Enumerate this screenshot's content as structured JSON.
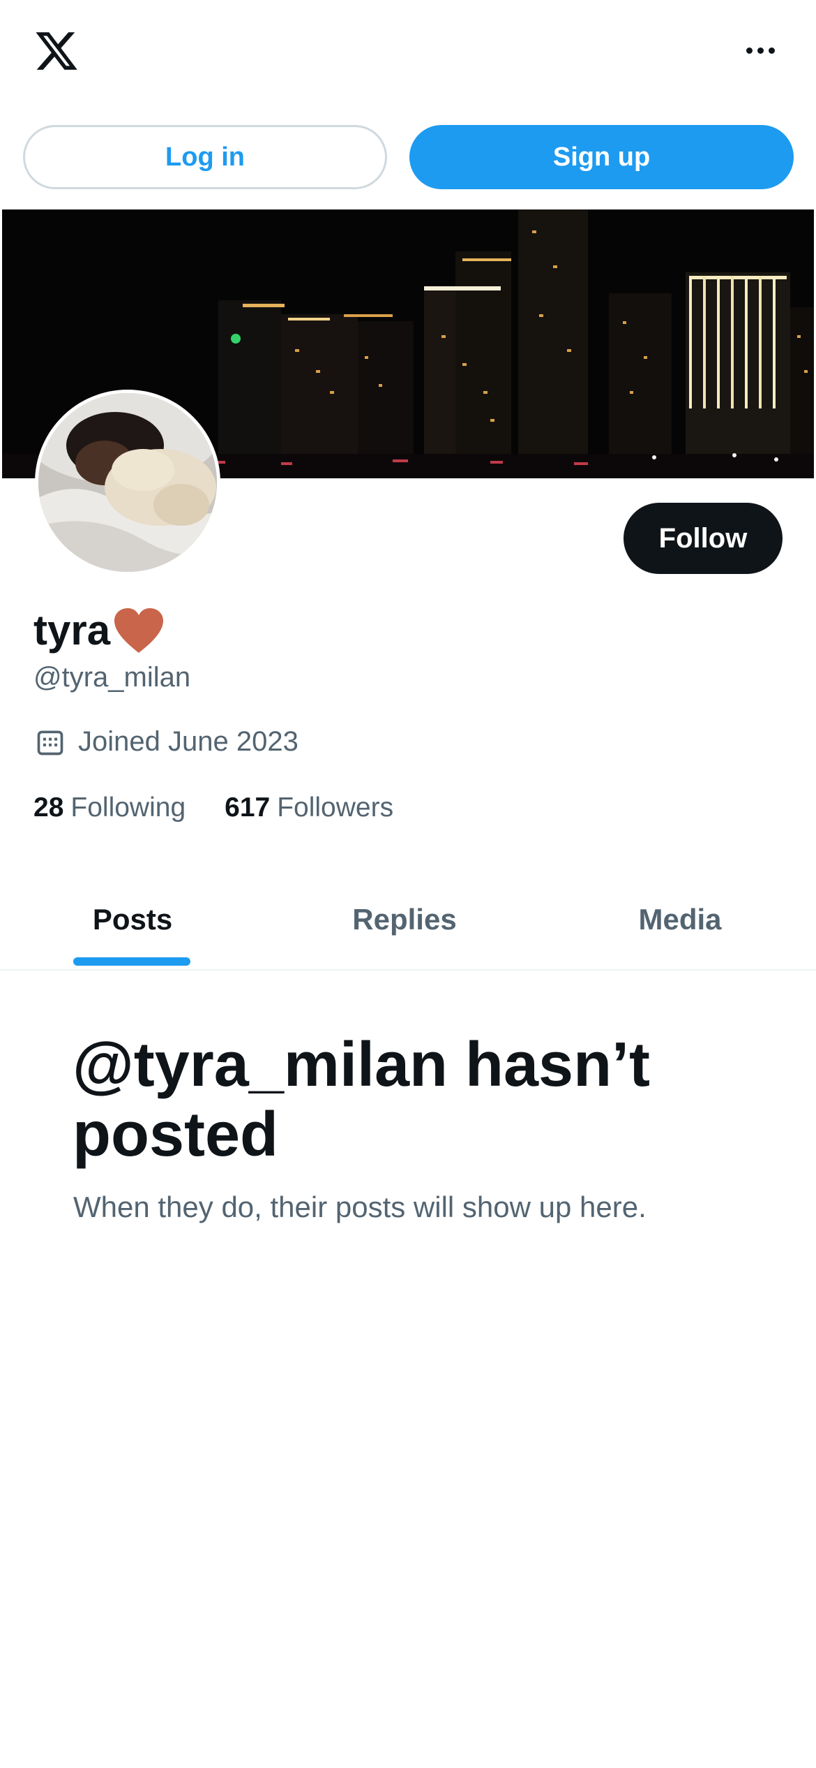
{
  "header": {
    "logo": "x-logo-icon",
    "more": "more-options-icon"
  },
  "auth": {
    "login_label": "Log in",
    "signup_label": "Sign up"
  },
  "profile": {
    "display_name": "tyra",
    "name_emoji": "heart",
    "handle": "@tyra_milan",
    "joined": "Joined June 2023",
    "following_count": "28",
    "following_label": "Following",
    "followers_count": "617",
    "followers_label": "Followers",
    "follow_label": "Follow"
  },
  "tabs": [
    {
      "label": "Posts",
      "active": true
    },
    {
      "label": "Replies",
      "active": false
    },
    {
      "label": "Media",
      "active": false
    }
  ],
  "empty_state": {
    "title": "@tyra_milan hasn’t posted",
    "subtitle": "When they do, their posts will show up here."
  },
  "colors": {
    "accent": "#1d9bf0",
    "text_primary": "#0f1419",
    "text_secondary": "#536471",
    "heart": "#c8654a"
  }
}
